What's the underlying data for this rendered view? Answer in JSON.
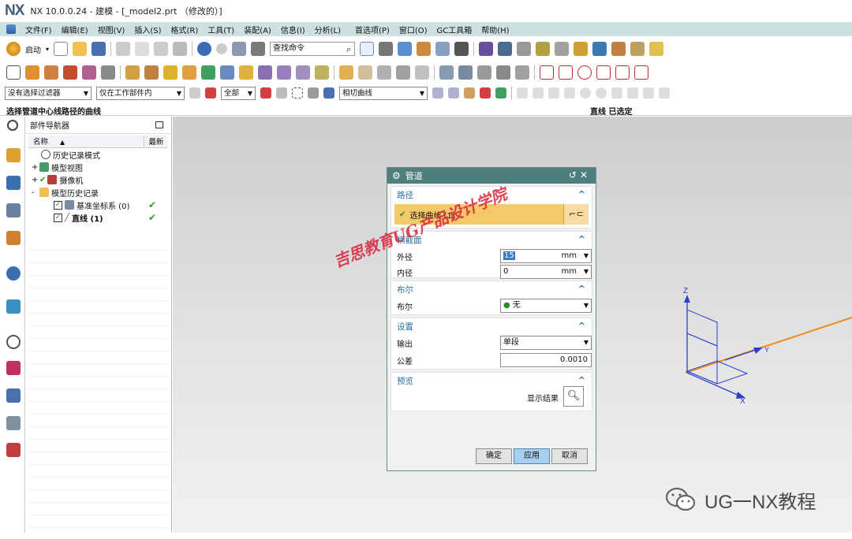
{
  "app": {
    "logo": "NX",
    "window_title": "NX 10.0.0.24 - 建模 - [_model2.prt （修改的）]"
  },
  "menu": {
    "items": [
      "文件(F)",
      "编辑(E)",
      "视图(V)",
      "插入(S)",
      "格式(R)",
      "工具(T)",
      "装配(A)",
      "信息(I)",
      "分析(L)",
      "首选项(P)",
      "窗口(O)",
      "GC工具箱",
      "帮助(H)"
    ]
  },
  "toolbar": {
    "start_label": "启动",
    "find_command_placeholder": "查找命令"
  },
  "selection_bar": {
    "filter": "没有选择过滤器",
    "scope": "仅在工作部件内",
    "all": "全部",
    "curve_rule": "相切曲线"
  },
  "status": {
    "prompt": "选择管道中心线路径的曲线",
    "message": "直线 已选定"
  },
  "part_navigator": {
    "title": "部件导航器",
    "col_name": "名称",
    "col_latest": "最新",
    "rows": [
      {
        "label": "历史记录模式",
        "indent": 0
      },
      {
        "label": "模型视图",
        "indent": 0,
        "expander": "+"
      },
      {
        "label": "摄像机",
        "indent": 0,
        "expander": "+"
      },
      {
        "label": "模型历史记录",
        "indent": 0,
        "expander": "-"
      },
      {
        "label": "基准坐标系 (0)",
        "indent": 1,
        "checked": true,
        "latest": true
      },
      {
        "label": "直线 (1)",
        "indent": 1,
        "checked": true,
        "latest": true,
        "bold": true
      }
    ]
  },
  "dialog": {
    "title": "管道",
    "path_group": "路径",
    "select_curve": "选择曲线 (1)",
    "section_group": "横截面",
    "outer_label": "外径",
    "outer_value": "15",
    "outer_unit": "mm",
    "inner_label": "内径",
    "inner_value": "0",
    "inner_unit": "mm",
    "bool_group": "布尔",
    "bool_label": "布尔",
    "bool_value": "无",
    "settings_group": "设置",
    "output_label": "输出",
    "output_value": "单段",
    "tolerance_label": "公差",
    "tolerance_value": "0.0010",
    "preview_group": "预览",
    "show_result": "显示结果",
    "ok": "确定",
    "apply": "应用",
    "cancel": "取消"
  },
  "triad": {
    "z": "Z",
    "x": "X",
    "y": "Y"
  },
  "watermark": {
    "text": "吉思教育UG产品设计学院"
  },
  "brand": {
    "text": "UG一NX教程"
  },
  "colors": {
    "menubar_bg": "#cfe1df",
    "dialog_title_bg": "#4f7f7c",
    "selected_curve_bg": "#f4c96a",
    "triad_blue": "#2c3fd0",
    "curve_orange": "#f08a1c"
  }
}
